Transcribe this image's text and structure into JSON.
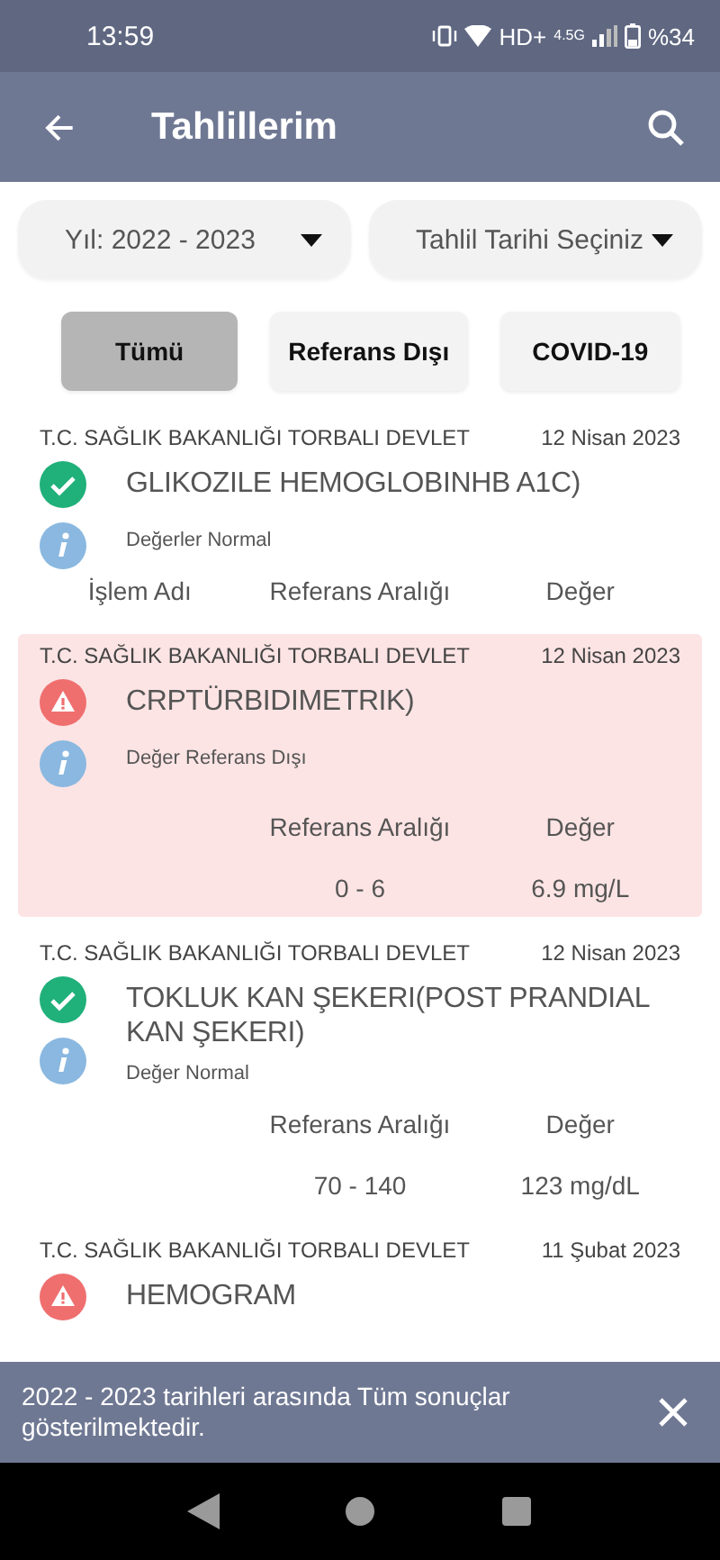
{
  "status_bar": {
    "time": "13:59",
    "network": "HD+",
    "network_type": "4.5G",
    "battery": "%34"
  },
  "app_bar": {
    "title": "Tahlillerim"
  },
  "filters": [
    {
      "label": "Yıl: 2022 - 2023"
    },
    {
      "label": "Tahlil Tarihi Seçiniz"
    }
  ],
  "tabs": [
    {
      "label": "Tümü",
      "selected": true
    },
    {
      "label": "Referans Dışı",
      "selected": false
    },
    {
      "label": "COVID-19",
      "selected": false
    }
  ],
  "results": [
    {
      "source": "T.C. SAĞLIK BAKANLIĞI TORBALI DEVLET",
      "date": "12 Nisan 2023",
      "kind": "normal",
      "highlighted": false,
      "name": "GLIKOZILE HEMOGLOBINHB A1C)",
      "note": "Değerler Normal",
      "columns": {
        "name": "İşlem Adı",
        "range": "Referans Aralığı",
        "value": "Değer"
      }
    },
    {
      "source": "T.C. SAĞLIK BAKANLIĞI TORBALI DEVLET",
      "date": "12 Nisan 2023",
      "kind": "abnormal",
      "highlighted": true,
      "name": "CRPTÜRBIDIMETRIK)",
      "note": "Değer Referans Dışı",
      "columns": {
        "range": "Referans Aralığı",
        "value": "Değer"
      },
      "values": {
        "range": "0 - 6",
        "value": "6.9 mg/L"
      }
    },
    {
      "source": "T.C. SAĞLIK BAKANLIĞI TORBALI DEVLET",
      "date": "12 Nisan 2023",
      "kind": "normal",
      "highlighted": false,
      "name": "TOKLUK KAN ŞEKERI(POST PRANDIAL KAN ŞEKERI)",
      "note": "Değer Normal",
      "columns": {
        "range": "Referans Aralığı",
        "value": "Değer"
      },
      "values": {
        "range": "70 - 140",
        "value": "123 mg/dL"
      }
    },
    {
      "source": "T.C. SAĞLIK BAKANLIĞI TORBALI DEVLET",
      "date": "11 Şubat 2023",
      "kind": "abnormal",
      "highlighted": false,
      "name": "HEMOGRAM"
    }
  ],
  "snackbar": {
    "message": "2022 - 2023 tarihleri arasında Tüm sonuçlar gösterilmektedir."
  }
}
